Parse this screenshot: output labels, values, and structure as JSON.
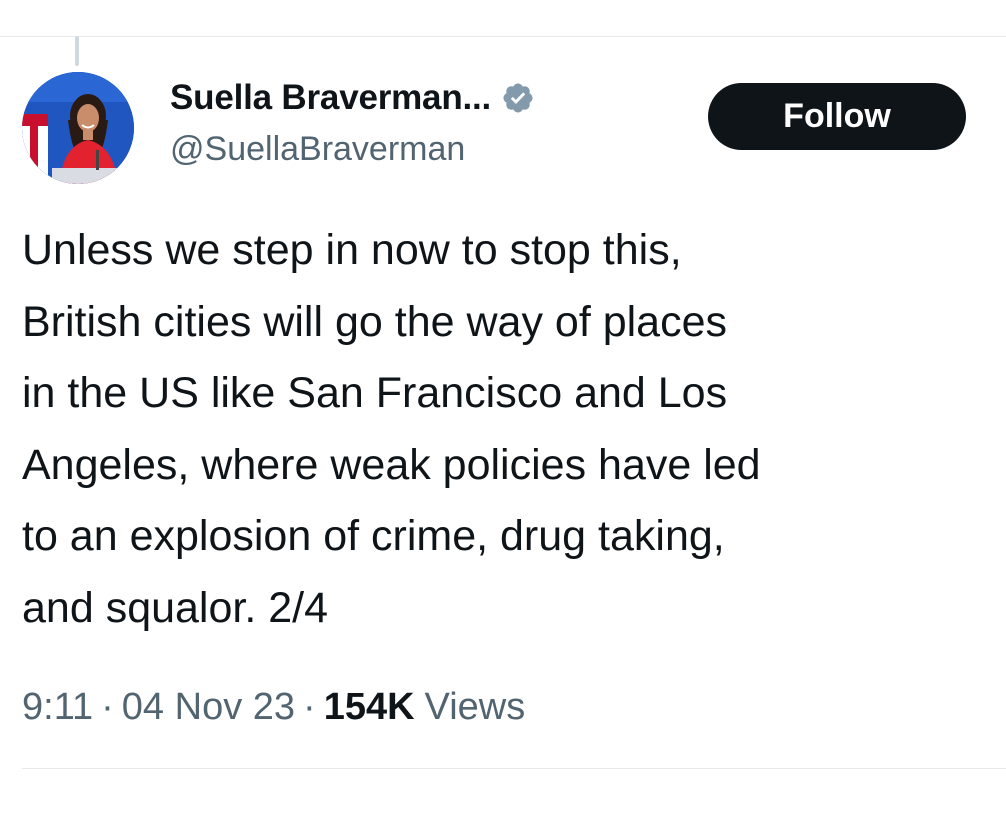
{
  "tweet": {
    "author": {
      "display_name": "Suella Braverman...",
      "handle": "@SuellaBraverman",
      "verified_icon": "verified-badge-icon",
      "avatar": "profile-photo"
    },
    "follow_label": "Follow",
    "text_lines": [
      "Unless we step in now to stop this,",
      "British cities will go the way of places",
      "in the US like San Francisco and Los",
      "Angeles, where weak policies have led",
      "to an explosion of crime, drug taking,",
      "and squalor. 2/4"
    ],
    "time": "9:11",
    "date": "04 Nov 23",
    "separator": "·",
    "views_count": "154K",
    "views_label": "Views"
  },
  "colors": {
    "text_primary": "#0f1419",
    "text_secondary": "#536471",
    "follow_bg": "#0f1419",
    "verified_badge": "#829aab"
  }
}
